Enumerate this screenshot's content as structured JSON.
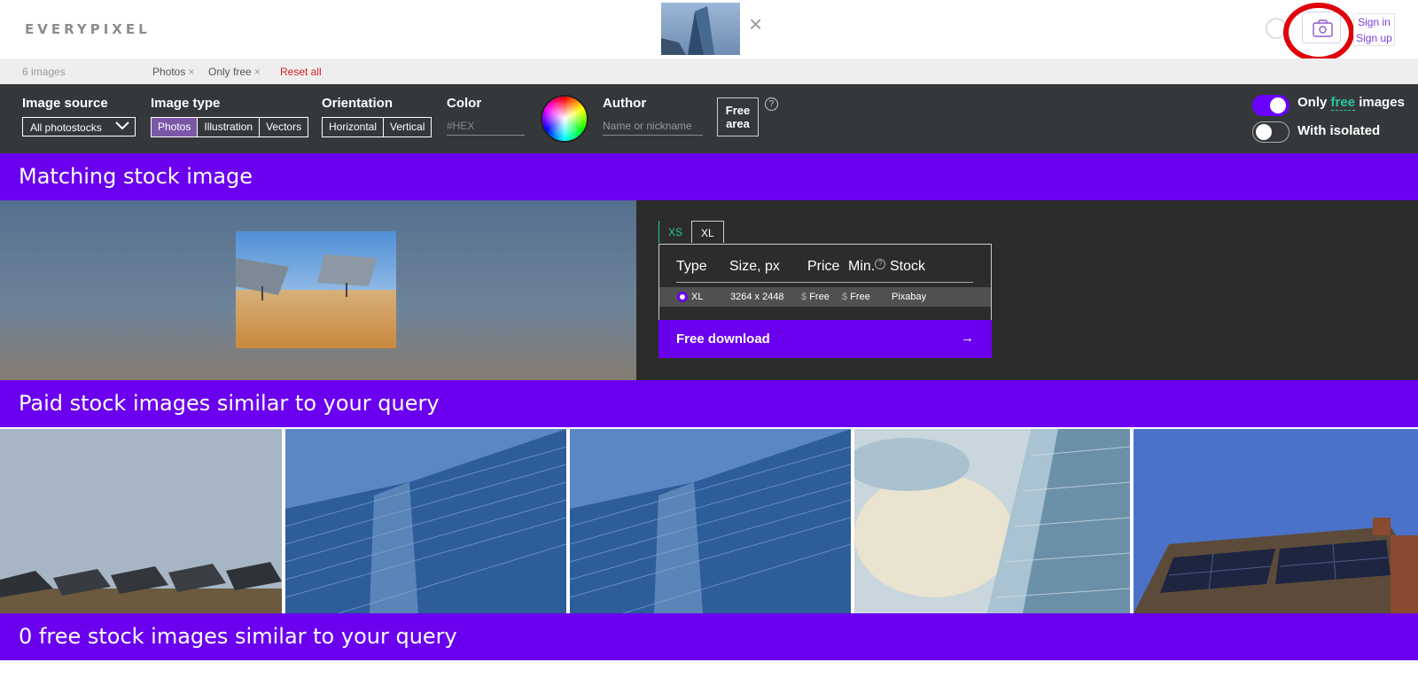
{
  "header": {
    "logo_text": "EVERYPIXEL",
    "sign_in": "Sign in",
    "sign_up": "Sign up",
    "close_symbol": "×",
    "query_thumb_icon": "building-thumbnail",
    "camera_icon": "camera-icon"
  },
  "filter_strip": {
    "count": "6 images",
    "tags": [
      "Photos",
      "Only free"
    ],
    "remove_symbol": "×",
    "reset": "Reset all"
  },
  "filters": {
    "image_source_label": "Image source",
    "image_source_value": "All photostocks",
    "image_type_label": "Image type",
    "image_types": [
      "Photos",
      "Illustration",
      "Vectors"
    ],
    "orientation_label": "Orientation",
    "orientations": [
      "Horizontal",
      "Vertical"
    ],
    "color_label": "Color",
    "hex_placeholder": "#HEX",
    "author_label": "Author",
    "author_placeholder": "Name or nickname",
    "free_area_line1": "Free",
    "free_area_line2": "area",
    "help": "?",
    "only_free_pre": "Only ",
    "only_free_link": "free",
    "only_free_post": " images",
    "with_isolated": "With isolated"
  },
  "sections": {
    "matching_title": "Matching stock image",
    "paid_title": "Paid stock images similar to your query",
    "free_title": "0 free stock images similar to your query"
  },
  "matching": {
    "tabs": [
      "XS",
      "XL"
    ],
    "columns": {
      "type": "Type",
      "size": "Size, px",
      "price": "Price",
      "min": "Min.",
      "stock": "Stock"
    },
    "row": {
      "type": "XL",
      "size": "3264 x 2448",
      "currency": "$",
      "price": "Free",
      "min_currency": "$",
      "min": "Free",
      "stock": "Pixabay"
    },
    "download": "Free download",
    "arrow": "→"
  },
  "colors": {
    "brand_purple": "#6a00ee",
    "filter_bar": "#35383a",
    "accent_green": "#27c6a3",
    "reset_red": "#d72020"
  }
}
